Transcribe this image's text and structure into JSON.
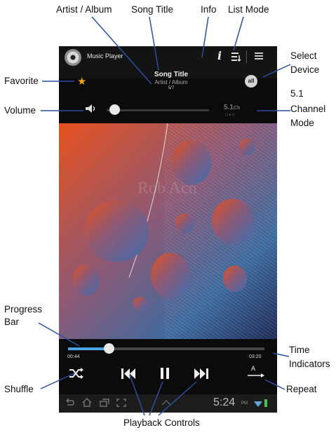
{
  "callouts": {
    "artist_album": "Artist / Album",
    "song_title": "Song Title",
    "info": "Info",
    "list_mode": "List Mode",
    "favorite": "Favorite",
    "select_device_1": "Select",
    "select_device_2": "Device",
    "volume": "Volume",
    "channel_1": "5.1",
    "channel_2": "Channel",
    "channel_3": "Mode",
    "progress_1": "Progress",
    "progress_2": "Bar",
    "time_1": "Time",
    "time_2": "Indicators",
    "shuffle": "Shuffle",
    "repeat": "Repeat",
    "playback": "Playback Controls"
  },
  "player": {
    "app_title": "Music Player",
    "info_glyph": "i",
    "song_title": "Song Title",
    "artist_album": "Artist / Album",
    "track_count": "5/7",
    "device_label": "all",
    "channel_mode": "5.1",
    "channel_unit": "Ch",
    "channel_sub": "((●))",
    "album_text": "Rob Acn",
    "elapsed": "00:44",
    "duration": "03:20",
    "repeat_letter": "A",
    "clock": "5:24",
    "ampm": "PM"
  },
  "state": {
    "volume_level": 0.05,
    "progress_fraction": 0.22,
    "favorite": true
  },
  "icons": [
    "app-disc-icon",
    "info-icon",
    "list-mode-icon",
    "menu-icon",
    "star-icon",
    "volume-icon",
    "shuffle-icon",
    "previous-icon",
    "pause-icon",
    "next-icon",
    "repeat-icon",
    "back-icon",
    "home-icon",
    "recent-apps-icon",
    "screenshot-icon",
    "up-arrow-icon",
    "wifi-icon",
    "battery-icon"
  ],
  "colors": {
    "progress": "#4aa3e0",
    "favorite": "#f0a21a",
    "callout_line": "#2b4fa0",
    "art_orange": "#e8501e",
    "art_blue": "#3d6a9e"
  }
}
